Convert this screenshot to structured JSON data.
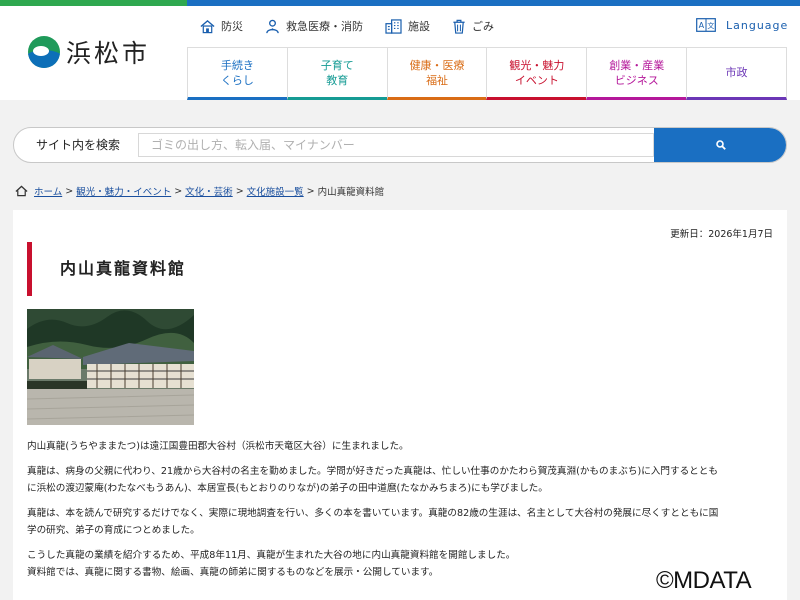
{
  "site": {
    "logo_text": "浜松市"
  },
  "utility_links": [
    {
      "label": "防災",
      "icon": "house-shield-icon"
    },
    {
      "label": "救急医療・消防",
      "icon": "doctor-icon"
    },
    {
      "label": "施設",
      "icon": "building-icon"
    },
    {
      "label": "ごみ",
      "icon": "trash-icon"
    }
  ],
  "language": {
    "label": "Language",
    "icon": "translate-icon"
  },
  "nav": [
    {
      "line1": "手続き",
      "line2": "くらし",
      "color": "#1a6fc2"
    },
    {
      "line1": "子育て",
      "line2": "教育",
      "color": "#159b94"
    },
    {
      "line1": "健康・医療",
      "line2": "福祉",
      "color": "#d96c16"
    },
    {
      "line1": "観光・魅力",
      "line2": "イベント",
      "color": "#c8102e"
    },
    {
      "line1": "創業・産業",
      "line2": "ビジネス",
      "color": "#b4179a"
    },
    {
      "line1": "市政",
      "line2": "",
      "color": "#6b36b6"
    }
  ],
  "search": {
    "label": "サイト内を検索",
    "placeholder": "ゴミの出し方、転入届、マイナンバー",
    "button_icon": "search-icon"
  },
  "breadcrumb": {
    "items": [
      "ホーム",
      "観光・魅力・イベント",
      "文化・芸術",
      "文化施設一覧"
    ],
    "current": "内山真龍資料館",
    "separator": ">"
  },
  "page": {
    "updated": "更新日：2026年1月7日",
    "title": "内山真龍資料館",
    "paragraphs": [
      [
        "内山真龍(うちやままたつ)は遠江国豊田郡大谷村（浜松市天竜区大谷）に生まれました。"
      ],
      [
        "真龍は、病身の父親に代わり、21歳から大谷村の名主を勤めました。学問が好きだった真龍は、忙しい仕事のかたわら賀茂真淵(かものまぶち)に入門するととも",
        "に浜松の渡辺蒙庵(わたなべもうあん)、本居宣長(もとおりのりなが)の弟子の田中道麿(たなかみちまろ)にも学びました。"
      ],
      [
        "真龍は、本を読んで研究するだけでなく、実際に現地調査を行い、多くの本を書いています。真龍の82歳の生涯は、名主として大谷村の発展に尽くすとともに国",
        "学の研究、弟子の育成につとめました。"
      ],
      [
        "こうした真龍の業績を紹介するため、平成8年11月、真龍が生まれた大谷の地に内山真龍資料館を開館しました。",
        "資料館では、真龍に関する書物、絵画、真龍の師弟に関するものなどを展示・公開しています。"
      ]
    ]
  },
  "watermark": "©MDATA"
}
